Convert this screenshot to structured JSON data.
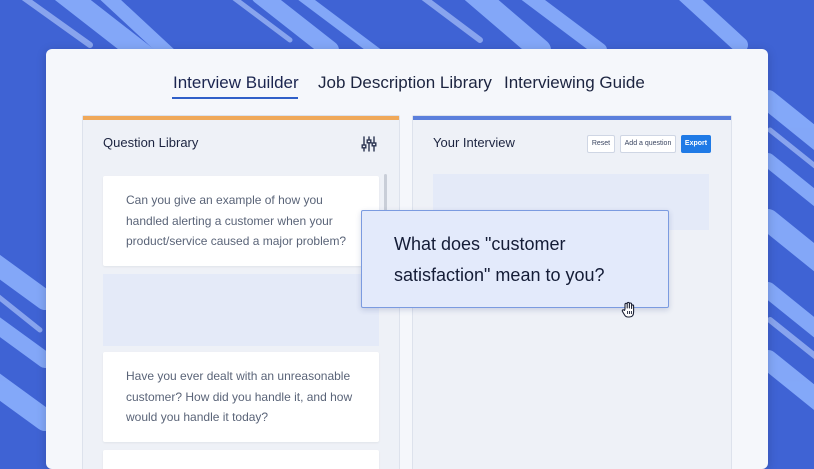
{
  "tabs": [
    {
      "label": "Interview Builder",
      "active": true
    },
    {
      "label": "Job Description Library",
      "active": false
    },
    {
      "label": "Interviewing Guide",
      "active": false
    }
  ],
  "question_library": {
    "title": "Question Library",
    "accent_color": "#f0a95a",
    "questions": [
      "Can you give an example of how you handled alerting a customer when your product/service caused a major problem?",
      "Have you ever dealt with an unreasonable customer? How did you handle it, and how would you handle it today?"
    ]
  },
  "your_interview": {
    "title": "Your Interview",
    "accent_color": "#5b7fdc",
    "buttons": {
      "reset": "Reset",
      "add_question": "Add a question",
      "export": "Export"
    }
  },
  "dragged_question": {
    "text": "What does \"customer satisfaction\" mean to you?"
  },
  "icons": [
    "filter-sliders-icon",
    "grab-hand-cursor-icon"
  ],
  "colors": {
    "background": "#3f63d4",
    "primary_button": "#1f7ae6",
    "tab_underline": "#2f5fc8"
  }
}
